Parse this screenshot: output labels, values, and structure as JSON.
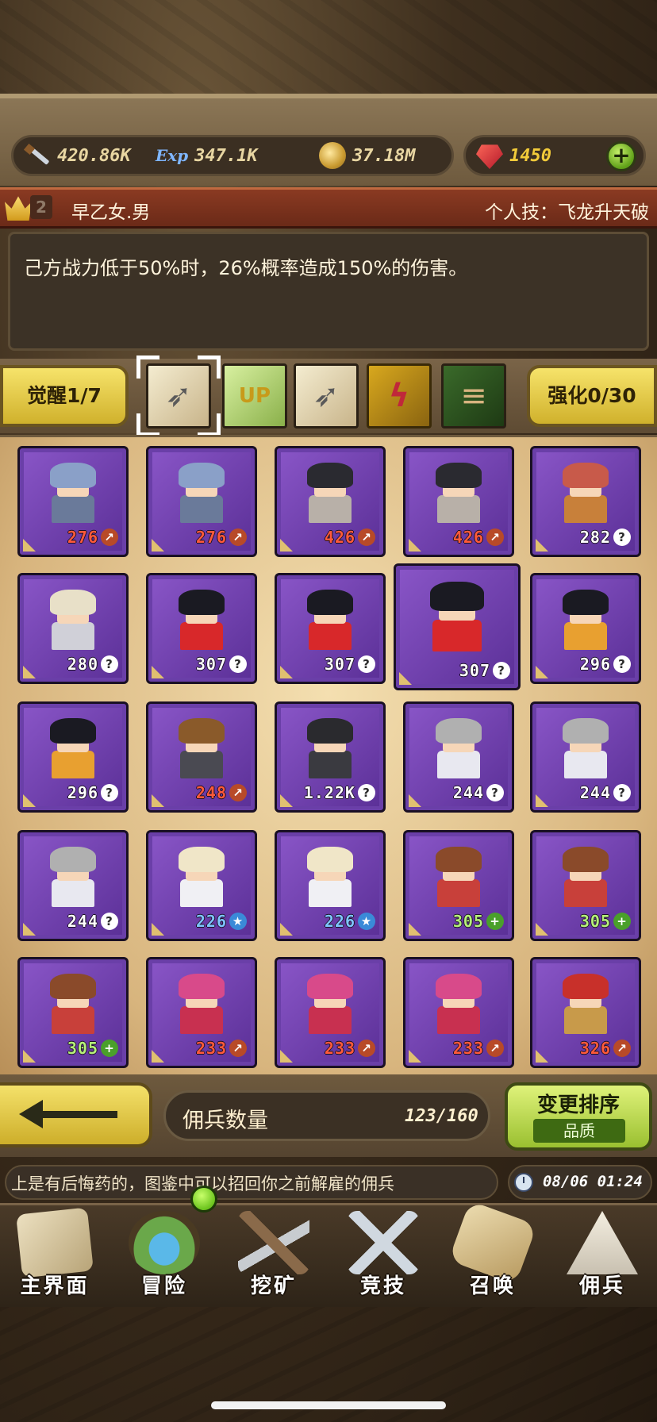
{
  "resources": {
    "attack": {
      "icon": "sword-icon",
      "value": "420.86K"
    },
    "exp": {
      "icon": "exp-icon",
      "label": "Exp",
      "value": "347.1K"
    },
    "gold": {
      "icon": "gold-coin-icon",
      "value": "37.18M"
    },
    "ruby": {
      "icon": "ruby-icon",
      "value": "1450"
    },
    "add_label": "+"
  },
  "hero": {
    "rank": "2",
    "name": "早乙女.男",
    "skill": "个人技：飞龙升天破",
    "description": "己方战力低于50%时，26%概率造成150%的伤害。"
  },
  "tabs": {
    "awaken": "觉醒1/7",
    "enhance": "强化0/30",
    "items": [
      {
        "name": "arrows",
        "glyph": "➶",
        "selected": true
      },
      {
        "name": "crown-up",
        "glyph": "UP",
        "selected": false
      },
      {
        "name": "arrows-handshake",
        "glyph": "➶",
        "selected": false
      },
      {
        "name": "rune",
        "glyph": "ϟ",
        "selected": false
      },
      {
        "name": "scroll-bundle",
        "glyph": "≡",
        "selected": false
      }
    ]
  },
  "mercenaries": [
    {
      "level": "276",
      "badge": "arrow",
      "hair": "#8aa0c8",
      "body": "#6a7a9a"
    },
    {
      "level": "276",
      "badge": "arrow",
      "hair": "#8aa0c8",
      "body": "#6a7a9a"
    },
    {
      "level": "426",
      "badge": "arrow",
      "hair": "#2a2a30",
      "body": "#b8b0a8"
    },
    {
      "level": "426",
      "badge": "arrow",
      "hair": "#2a2a30",
      "body": "#b8b0a8"
    },
    {
      "level": "282",
      "badge": "question",
      "hair": "#c85a4a",
      "body": "#c8803a"
    },
    {
      "level": "280",
      "badge": "question",
      "hair": "#e8e0c8",
      "body": "#d0d0d8"
    },
    {
      "level": "307",
      "badge": "question",
      "hair": "#1a1a22",
      "body": "#d8282a"
    },
    {
      "level": "307",
      "badge": "question",
      "hair": "#1a1a22",
      "body": "#d8282a"
    },
    {
      "level": "307",
      "badge": "question",
      "hair": "#1a1a22",
      "body": "#d8282a",
      "selected": true
    },
    {
      "level": "296",
      "badge": "question",
      "hair": "#1a1a22",
      "body": "#e8a030"
    },
    {
      "level": "296",
      "badge": "question",
      "hair": "#1a1a22",
      "body": "#e8a030"
    },
    {
      "level": "248",
      "badge": "arrow",
      "hair": "#8a5a2a",
      "body": "#4a4a52"
    },
    {
      "level": "1.22K",
      "badge": "question",
      "hair": "#2a2a2e",
      "body": "#3a3a40"
    },
    {
      "level": "244",
      "badge": "question",
      "hair": "#b0b0b0",
      "body": "#e8e8f0"
    },
    {
      "level": "244",
      "badge": "question",
      "hair": "#b0b0b0",
      "body": "#e8e8f0"
    },
    {
      "level": "244",
      "badge": "question",
      "hair": "#b0b0b0",
      "body": "#e8e8f0"
    },
    {
      "level": "226",
      "badge": "star",
      "hair": "#f0e6c8",
      "body": "#f0f0f4"
    },
    {
      "level": "226",
      "badge": "star",
      "hair": "#f0e6c8",
      "body": "#f0f0f4"
    },
    {
      "level": "305",
      "badge": "plus",
      "hair": "#8a4a2a",
      "body": "#c8403a"
    },
    {
      "level": "305",
      "badge": "plus",
      "hair": "#8a4a2a",
      "body": "#c8403a"
    },
    {
      "level": "305",
      "badge": "plus",
      "hair": "#8a4a2a",
      "body": "#c8403a"
    },
    {
      "level": "233",
      "badge": "arrow",
      "hair": "#d84a8a",
      "body": "#c83050"
    },
    {
      "level": "233",
      "badge": "arrow",
      "hair": "#d84a8a",
      "body": "#c83050"
    },
    {
      "level": "233",
      "badge": "arrow",
      "hair": "#d84a8a",
      "body": "#c83050"
    },
    {
      "level": "326",
      "badge": "arrow",
      "hair": "#c8302a",
      "body": "#c89a4a"
    }
  ],
  "badge_styles": {
    "arrow": {
      "symbol": "↗",
      "bg": "#b84a28",
      "fg": "#ffffff",
      "text": "#ff5a3a"
    },
    "question": {
      "symbol": "?",
      "bg": "#ffffff",
      "fg": "#2a2a2a",
      "text": "#ffffff"
    },
    "star": {
      "symbol": "★",
      "bg": "#3a8ad8",
      "fg": "#ffffff",
      "text": "#7ec4ff"
    },
    "plus": {
      "symbol": "+",
      "bg": "#4aa02a",
      "fg": "#ffffff",
      "text": "#b6f07a"
    }
  },
  "controls": {
    "count_label": "佣兵数量",
    "count_value": "123/160",
    "sort_label": "变更排序",
    "sort_mode": "品质"
  },
  "ticker": {
    "text": "上是有后悔药的，图鉴中可以招回你之前解雇的佣兵",
    "time": "08/06 01:24"
  },
  "nav": [
    {
      "label": "主界面",
      "icon": "map-scroll-icon",
      "color": "#d8c8a0"
    },
    {
      "label": "冒险",
      "icon": "island-icon",
      "color": "#6aa84a"
    },
    {
      "label": "挖矿",
      "icon": "pickaxe-icon",
      "color": "#8a6a4a"
    },
    {
      "label": "竞技",
      "icon": "crossed-swords-icon",
      "color": "#b8c0c8"
    },
    {
      "label": "召唤",
      "icon": "summon-scroll-icon",
      "color": "#d8c090"
    },
    {
      "label": "佣兵",
      "icon": "tent-icon",
      "color": "#e8e0d0"
    }
  ]
}
